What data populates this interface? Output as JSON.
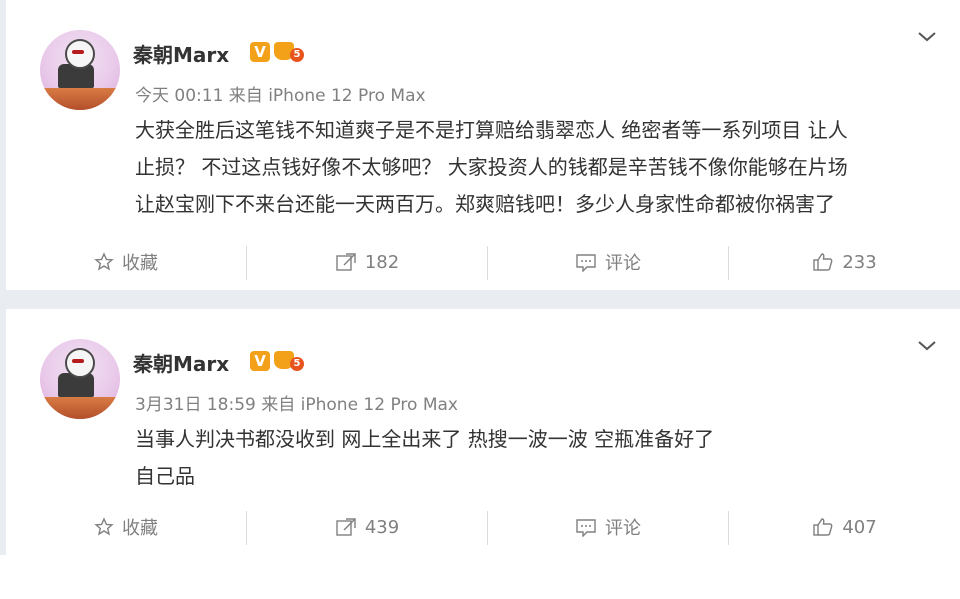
{
  "posts": [
    {
      "author": "秦朝Marx",
      "verified_badge": "V",
      "level_badge": "5",
      "meta": "今天 00:11 来自 iPhone 12 Pro Max",
      "lines": [
        "大获全胜后这笔钱不知道爽子是不是打算赔给翡翠恋人 绝密者等一系列项目 让人",
        "止损？ 不过这点钱好像不太够吧？ 大家投资人的钱都是辛苦钱不像你能够在片场",
        "让赵宝刚下不来台还能一天两百万。郑爽赔钱吧！多少人身家性命都被你祸害了"
      ],
      "actions": {
        "favorite_label": "收藏",
        "repost_count": "182",
        "comment_label": "评论",
        "like_count": "233"
      }
    },
    {
      "author": "秦朝Marx",
      "verified_badge": "V",
      "level_badge": "5",
      "meta": "3月31日 18:59 来自 iPhone 12 Pro Max",
      "lines": [
        "当事人判决书都没收到 网上全出来了  热搜一波一波 空瓶准备好了",
        "自己品"
      ],
      "actions": {
        "favorite_label": "收藏",
        "repost_count": "439",
        "comment_label": "评论",
        "like_count": "407"
      }
    }
  ],
  "colors": {
    "background": "#e9edf2",
    "text": "#333333",
    "meta": "#808080",
    "badge_v": "#f4a11a",
    "badge_level": "#e8541e"
  }
}
